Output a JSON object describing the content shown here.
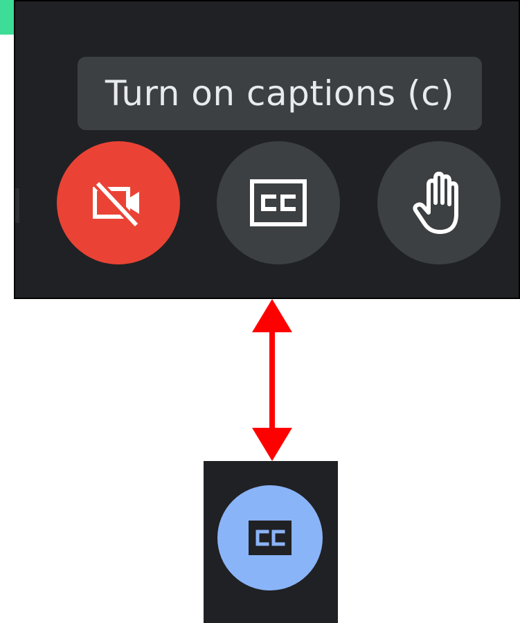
{
  "tooltip": {
    "text": "Turn on captions (c)"
  },
  "toolbar": {
    "buttons": [
      {
        "name": "camera-off-button",
        "icon": "video-off-icon",
        "color": "#ea4335",
        "state": "camera off"
      },
      {
        "name": "captions-button",
        "icon": "closed-captions-icon",
        "color": "#3c4043",
        "state": "captions off"
      },
      {
        "name": "raise-hand-button",
        "icon": "raise-hand-icon",
        "color": "#3c4043",
        "state": "not raised"
      }
    ]
  },
  "captions_active_button": {
    "icon": "closed-captions-icon",
    "color": "#8ab4f8",
    "state": "captions on"
  },
  "arrow": {
    "color": "#ff0000"
  },
  "colors": {
    "panel_bg": "#202124",
    "tooltip_bg": "#3c4043",
    "tooltip_text": "#e8eaed",
    "accent_green": "#3ddc97"
  }
}
